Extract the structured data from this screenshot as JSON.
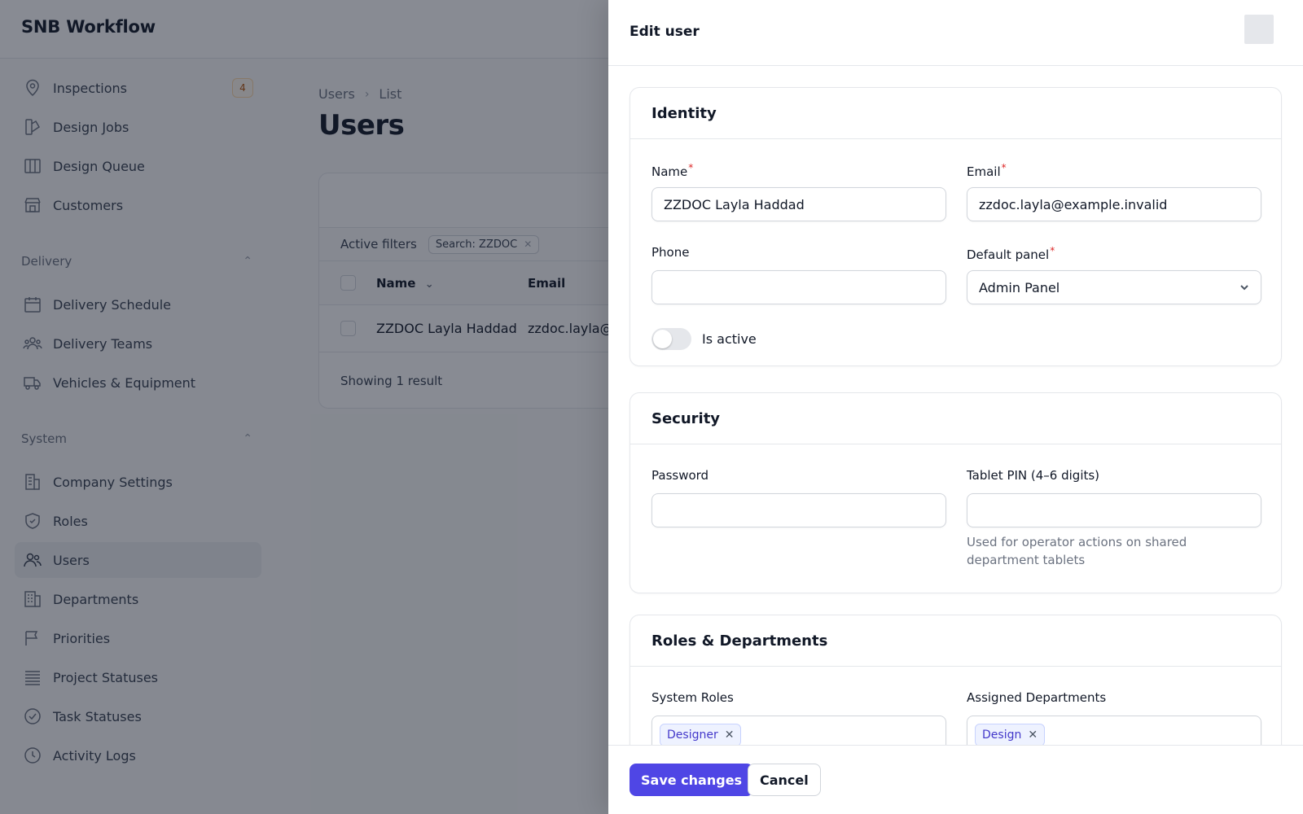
{
  "app": {
    "brand": "SNB Workflow"
  },
  "sidebar": {
    "top_items": [
      {
        "label": "Inspections",
        "icon": "map-pin-icon",
        "badge": "4"
      },
      {
        "label": "Design Jobs",
        "icon": "swatch-icon"
      },
      {
        "label": "Design Queue",
        "icon": "columns-icon"
      },
      {
        "label": "Customers",
        "icon": "storefront-icon"
      }
    ],
    "groups": [
      {
        "title": "Delivery",
        "items": [
          {
            "label": "Delivery Schedule",
            "icon": "calendar-icon"
          },
          {
            "label": "Delivery Teams",
            "icon": "user-group-icon"
          },
          {
            "label": "Vehicles & Equipment",
            "icon": "truck-icon"
          }
        ]
      },
      {
        "title": "System",
        "items": [
          {
            "label": "Company Settings",
            "icon": "building-icon"
          },
          {
            "label": "Roles",
            "icon": "shield-check-icon"
          },
          {
            "label": "Users",
            "icon": "users-icon",
            "active": true
          },
          {
            "label": "Departments",
            "icon": "office-building-icon"
          },
          {
            "label": "Priorities",
            "icon": "flag-icon"
          },
          {
            "label": "Project Statuses",
            "icon": "bars-icon"
          },
          {
            "label": "Task Statuses",
            "icon": "check-circle-icon"
          },
          {
            "label": "Activity Logs",
            "icon": "clock-icon"
          }
        ]
      }
    ]
  },
  "main": {
    "breadcrumb": [
      "Users",
      "List"
    ],
    "title": "Users",
    "active_filters_label": "Active filters",
    "filter_chip": "Search: ZZDOC",
    "columns": [
      "Name",
      "Email"
    ],
    "rows": [
      {
        "name": "ZZDOC Layla Haddad",
        "email": "zzdoc.layla@"
      }
    ],
    "showing": "Showing 1 result"
  },
  "panel": {
    "title": "Edit user",
    "identity": {
      "heading": "Identity",
      "name_label": "Name",
      "name_value": "ZZDOC Layla Haddad",
      "email_label": "Email",
      "email_value": "zzdoc.layla@example.invalid",
      "phone_label": "Phone",
      "phone_value": "",
      "default_panel_label": "Default panel",
      "default_panel_value": "Admin Panel",
      "is_active_label": "Is active",
      "is_active": false
    },
    "security": {
      "heading": "Security",
      "password_label": "Password",
      "password_value": "",
      "pin_label": "Tablet PIN (4–6 digits)",
      "pin_value": "",
      "pin_hint": "Used for operator actions on shared department tablets"
    },
    "roles": {
      "heading": "Roles & Departments",
      "system_roles_label": "System Roles",
      "system_roles": [
        "Designer"
      ],
      "departments_label": "Assigned Departments",
      "departments": [
        "Design"
      ]
    },
    "footer": {
      "save_label": "Save changes",
      "cancel_label": "Cancel"
    }
  },
  "colors": {
    "primary": "#4f46e5",
    "required": "#dc2626",
    "tag_bg": "#eef2ff",
    "tag_text": "#4338ca",
    "overlay": "rgba(17,24,39,0.5)"
  }
}
